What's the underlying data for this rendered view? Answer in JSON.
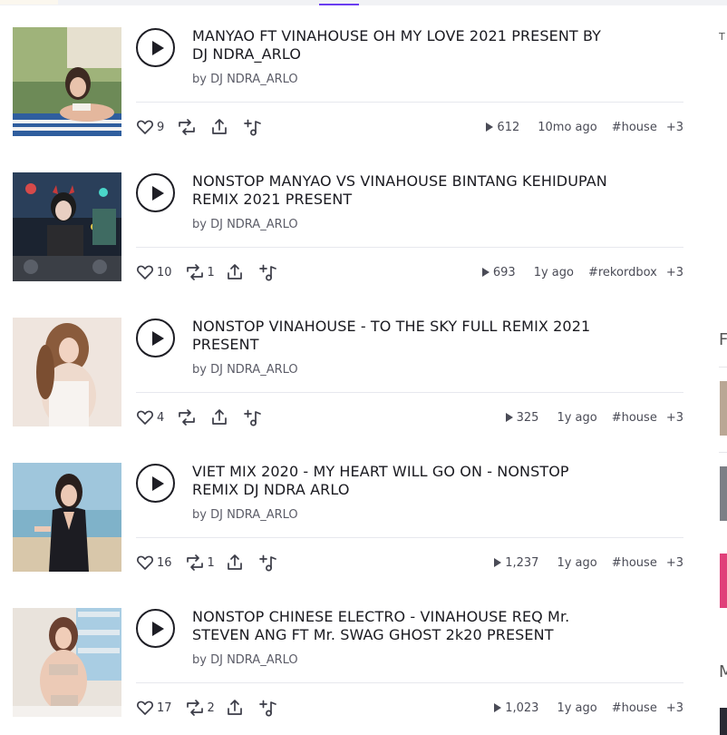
{
  "right_column": {
    "text_1": "T",
    "text_2": "F",
    "text_3": "M"
  },
  "tracks": [
    {
      "title": "MANYAO FT VINAHOUSE OH MY LOVE 2021 PRESENT BY DJ NDRA_ARLO",
      "by_prefix": "by",
      "artist": "DJ NDRA_ARLO",
      "likes": "9",
      "reposts": "",
      "plays": "612",
      "ago": "10mo ago",
      "tag": "#house",
      "more": "+3"
    },
    {
      "title": "NONSTOP MANYAO VS VINAHOUSE BINTANG KEHIDUPAN REMIX 2021 PRESENT",
      "by_prefix": "by",
      "artist": "DJ NDRA_ARLO",
      "likes": "10",
      "reposts": "1",
      "plays": "693",
      "ago": "1y ago",
      "tag": "#rekordbox",
      "more": "+3"
    },
    {
      "title": "NONSTOP VINAHOUSE - TO THE SKY FULL REMIX 2021 PRESENT",
      "by_prefix": "by",
      "artist": "DJ NDRA_ARLO",
      "likes": "4",
      "reposts": "",
      "plays": "325",
      "ago": "1y ago",
      "tag": "#house",
      "more": "+3"
    },
    {
      "title": "VIET MIX 2020 - MY HEART WILL GO ON - NONSTOP REMIX DJ NDRA ARLO",
      "by_prefix": "by",
      "artist": "DJ NDRA_ARLO",
      "likes": "16",
      "reposts": "1",
      "plays": "1,237",
      "ago": "1y ago",
      "tag": "#house",
      "more": "+3"
    },
    {
      "title": "NONSTOP CHINESE ELECTRO - VINAHOUSE REQ Mr. STEVEN ANG FT Mr. SWAG GHOST 2k20 PRESENT",
      "by_prefix": "by",
      "artist": "DJ NDRA_ARLO",
      "likes": "17",
      "reposts": "2",
      "plays": "1,023",
      "ago": "1y ago",
      "tag": "#house",
      "more": "+3"
    }
  ],
  "icons": {
    "play": "play-icon",
    "like": "heart-icon",
    "repost": "repost-icon",
    "share": "share-icon",
    "add": "add-to-playlist-icon",
    "plays": "play-count-icon"
  },
  "colors": {
    "accent": "#6b3df0",
    "text": "#1a1a20",
    "muted": "#5c5d68",
    "divider": "#e7e8ee"
  }
}
